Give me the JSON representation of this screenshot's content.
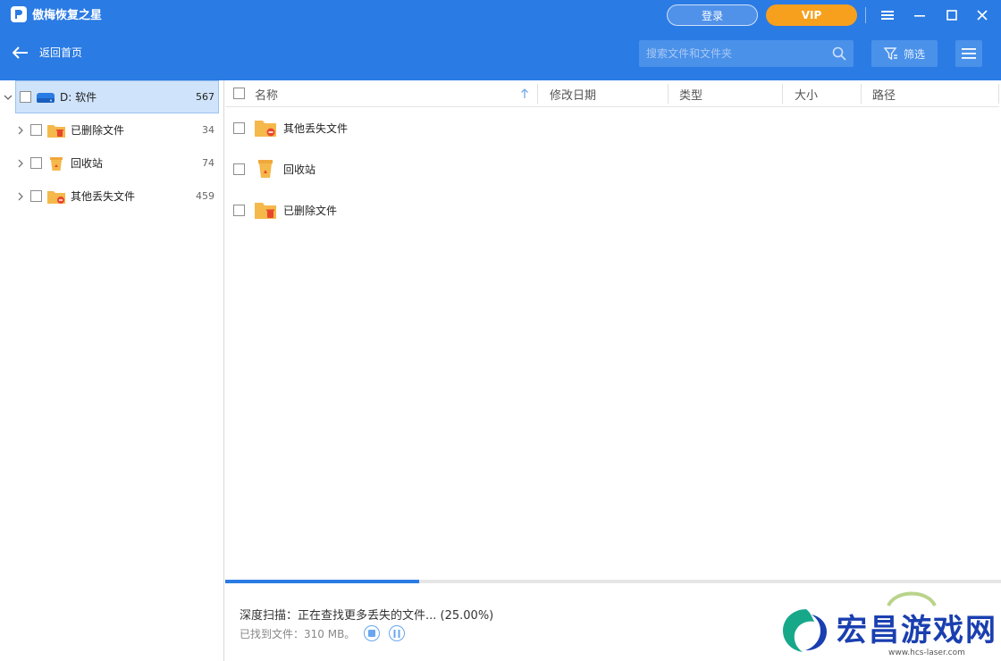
{
  "app": {
    "title": "傲梅恢复之星",
    "login_label": "登录",
    "vip_label": "VIP"
  },
  "header": {
    "back_label": "返回首页",
    "search_placeholder": "搜索文件和文件夹",
    "filter_label": "筛选"
  },
  "sidebar": {
    "root": {
      "label": "D: 软件",
      "count": "567"
    },
    "items": [
      {
        "label": "已删除文件",
        "count": "34",
        "icon": "deleted-folder-icon"
      },
      {
        "label": "回收站",
        "count": "74",
        "icon": "recycle-bin-icon"
      },
      {
        "label": "其他丢失文件",
        "count": "459",
        "icon": "lost-folder-icon"
      }
    ]
  },
  "table": {
    "columns": [
      "名称",
      "修改日期",
      "类型",
      "大小",
      "路径"
    ],
    "rows": [
      {
        "name": "其他丢失文件",
        "icon": "lost-folder-icon"
      },
      {
        "name": "回收站",
        "icon": "recycle-bin-icon"
      },
      {
        "name": "已删除文件",
        "icon": "deleted-folder-icon"
      }
    ]
  },
  "scan": {
    "status": "深度扫描：正在查找更多丢失的文件... (25.00%)",
    "found": "已找到文件：310 MB。",
    "progress_percent": 25
  },
  "watermark": {
    "text": "宏昌游戏网",
    "url": "www.hcs-laser.com"
  },
  "colors": {
    "accent": "#2a7be4",
    "vip": "#f7a01e",
    "folder": "#f5b84b"
  }
}
